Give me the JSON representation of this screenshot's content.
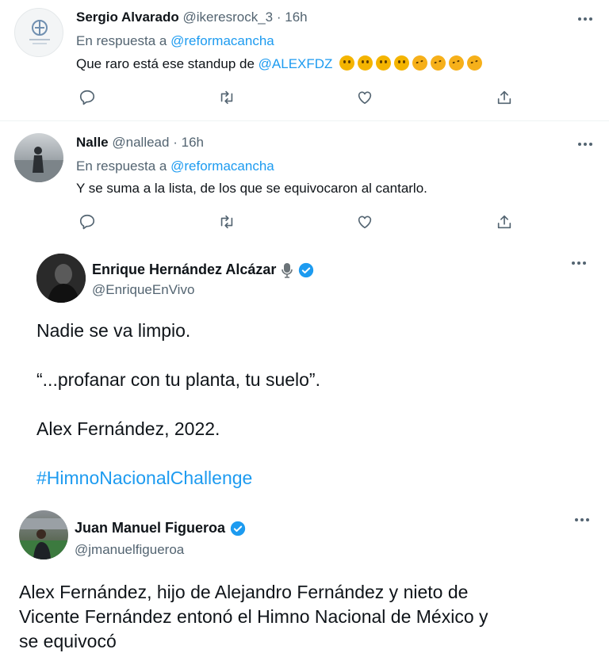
{
  "replies": [
    {
      "name": "Sergio Alvarado",
      "handle": "@ikeresrock_3",
      "time": "16h",
      "in_reply_prefix": "En respuesta a",
      "in_reply_handle": "@reformacancha",
      "text": "Que raro está ese standup de",
      "mention": "@ALEXFDZ",
      "emoji": [
        "thinking-face",
        "thinking-face",
        "thinking-face",
        "thinking-face",
        "rofl-face",
        "rofl-face",
        "rofl-face",
        "rofl-face"
      ]
    },
    {
      "name": "Nalle",
      "handle": "@nallead",
      "time": "16h",
      "in_reply_prefix": "En respuesta a",
      "in_reply_handle": "@reformacancha",
      "text": "Y se suma a la lista, de los que se equivocaron al cantarlo."
    }
  ],
  "separator": "·",
  "quotes": [
    {
      "name": "Enrique Hernández Alcázar",
      "name_icon": "microphone-icon",
      "handle": "@EnriqueEnVivo",
      "lines": [
        "Nadie se va limpio.",
        "“...profanar con tu planta, tu suelo”.",
        "Alex Fernández, 2022."
      ],
      "hashtag": "#HimnoNacionalChallenge"
    },
    {
      "name": "Juan Manuel Figueroa",
      "handle": "@jmanuelfigueroa",
      "lines": [
        "Alex Fernández, hijo de Alejandro Fernández y nieto de",
        "Vicente Fernández entonó el Himno Nacional de México y",
        "se equivocó"
      ]
    }
  ],
  "colors": {
    "link": "#1d9bf0",
    "muted": "#536471",
    "text": "#0f1419",
    "divider": "#eff3f4"
  }
}
